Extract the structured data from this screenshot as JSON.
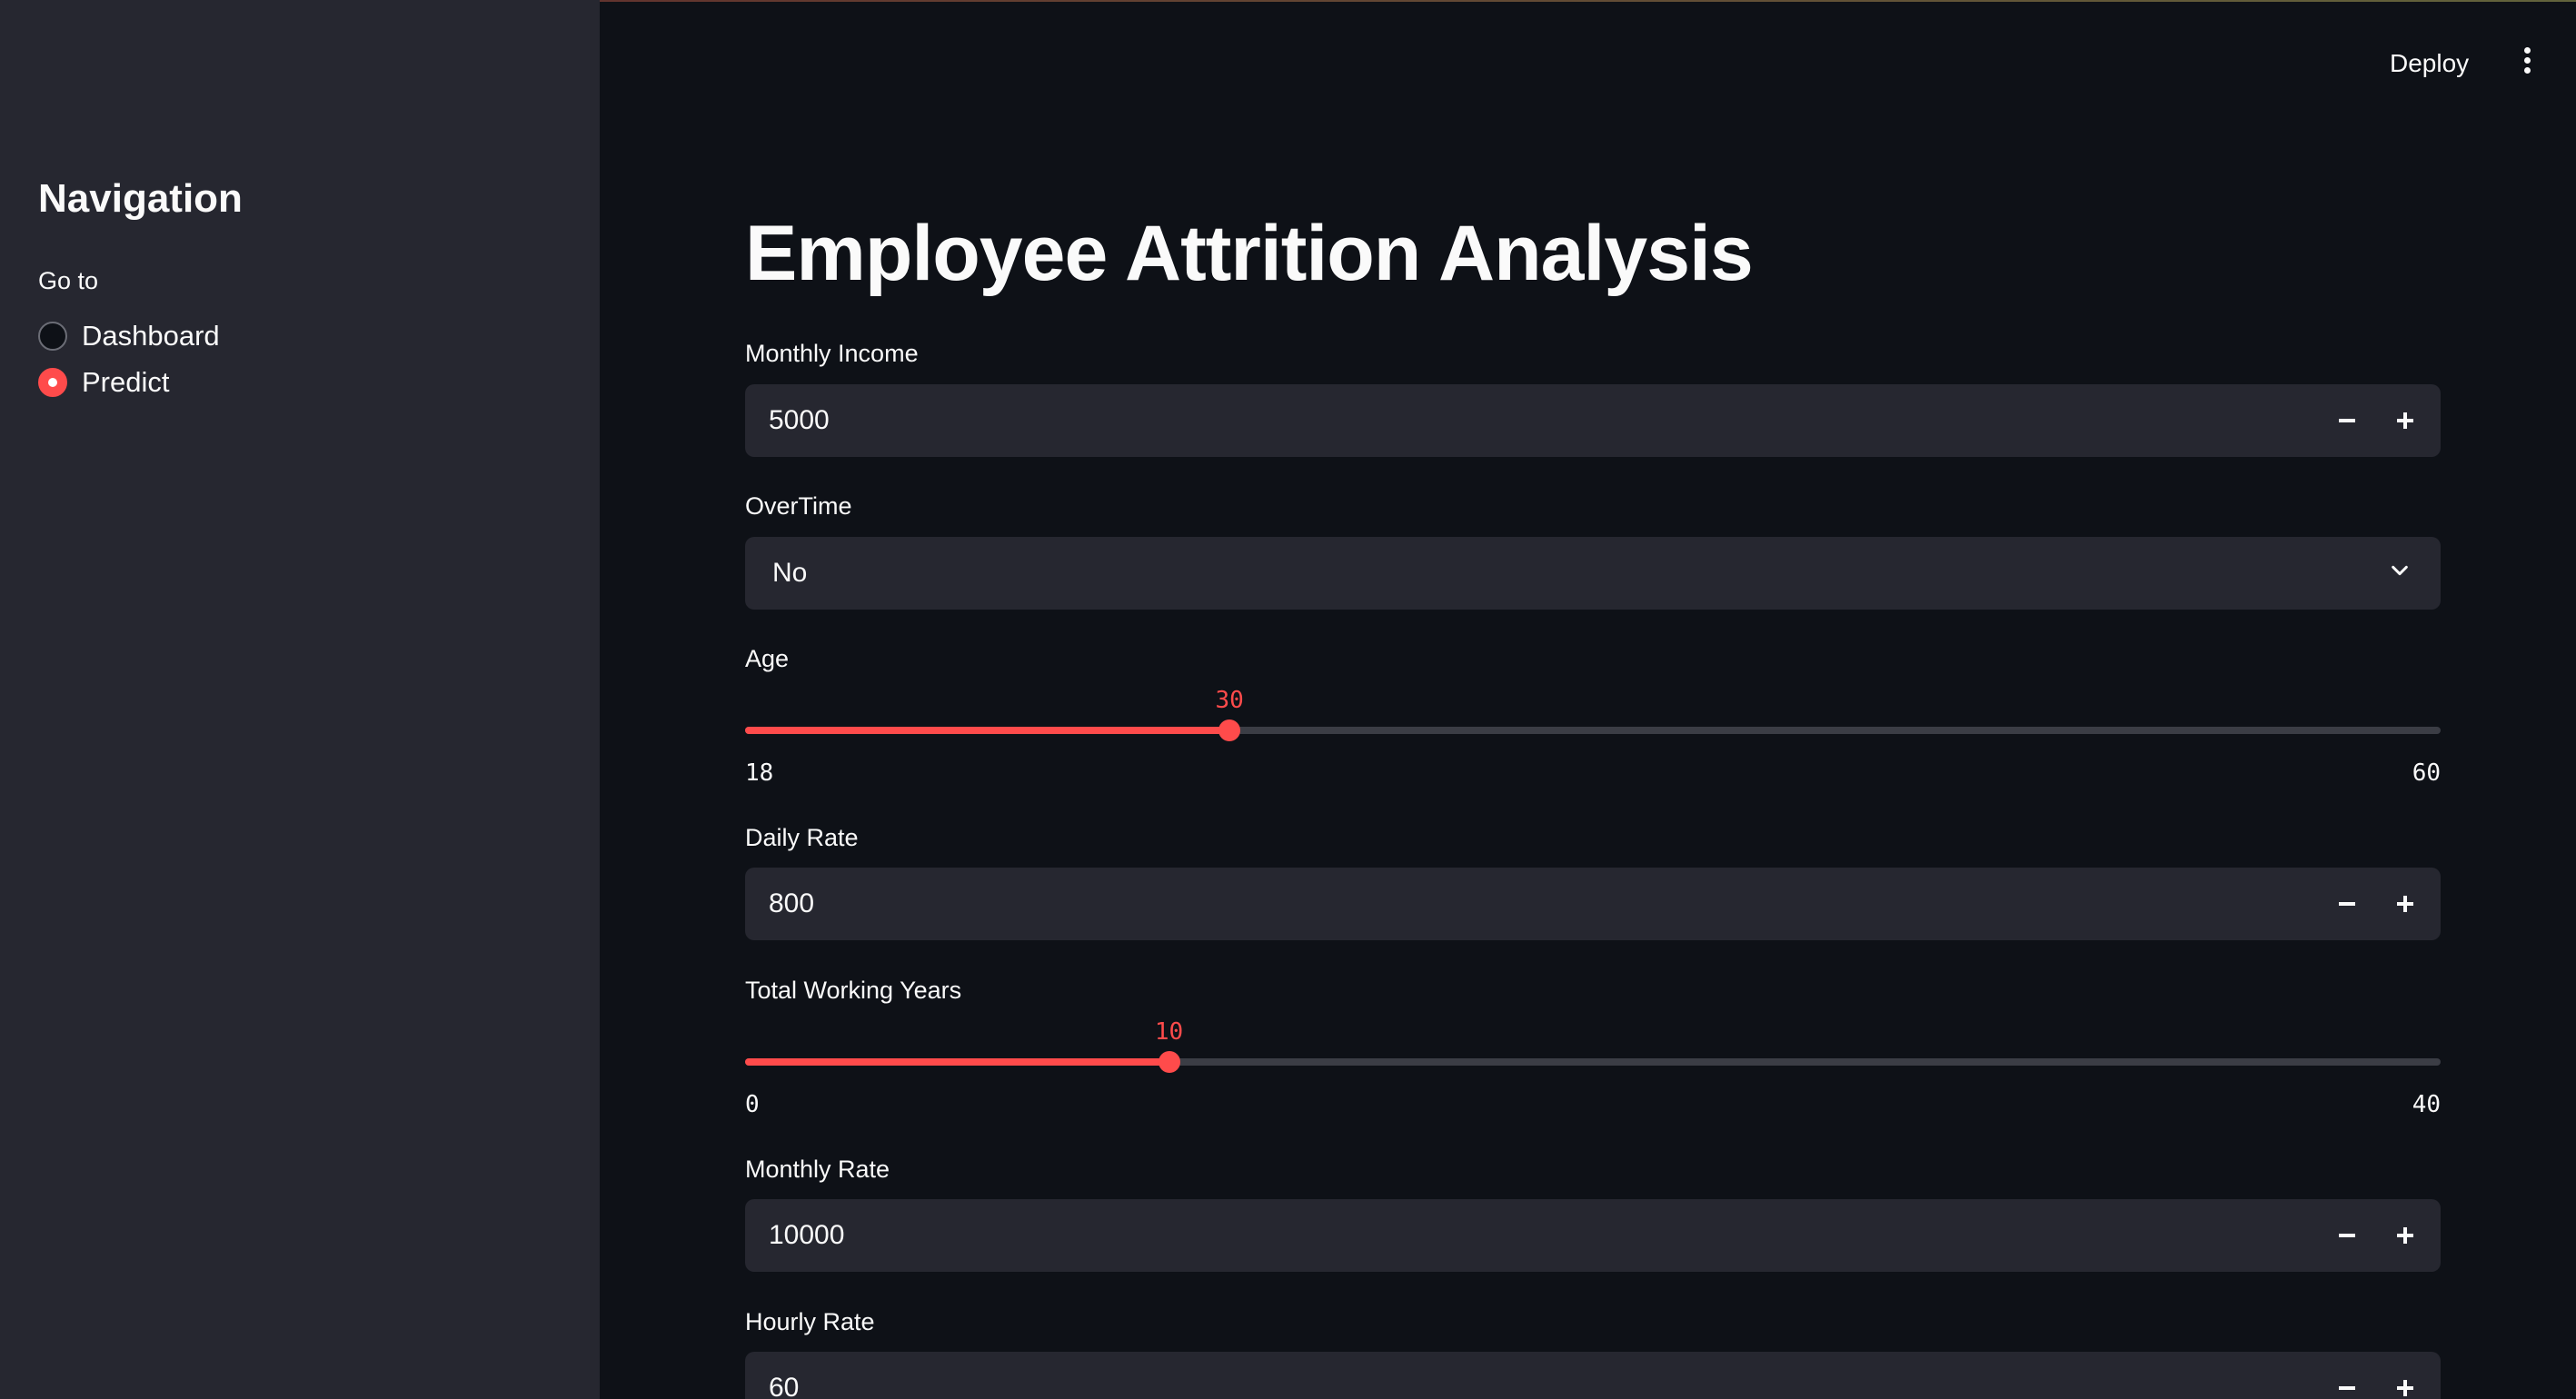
{
  "sidebar": {
    "title": "Navigation",
    "radio_label": "Go to",
    "options": [
      {
        "label": "Dashboard",
        "checked": false
      },
      {
        "label": "Predict",
        "checked": true
      }
    ]
  },
  "header": {
    "deploy_label": "Deploy",
    "menu_icon": "vertical-ellipsis-icon"
  },
  "main": {
    "title": "Employee Attrition Analysis",
    "monthly_income": {
      "label": "Monthly Income",
      "value": "5000"
    },
    "overtime": {
      "label": "OverTime",
      "value": "No"
    },
    "age": {
      "label": "Age",
      "value": "30",
      "min": "18",
      "max": "60"
    },
    "daily_rate": {
      "label": "Daily Rate",
      "value": "800"
    },
    "total_working_years": {
      "label": "Total Working Years",
      "value": "10",
      "min": "0",
      "max": "40"
    },
    "monthly_rate": {
      "label": "Monthly Rate",
      "value": "10000"
    },
    "hourly_rate": {
      "label": "Hourly Rate",
      "value": "60"
    }
  },
  "colors": {
    "accent": "#ff4b4b",
    "background": "#0e1117",
    "sidebar": "#262730",
    "input": "#262730"
  }
}
